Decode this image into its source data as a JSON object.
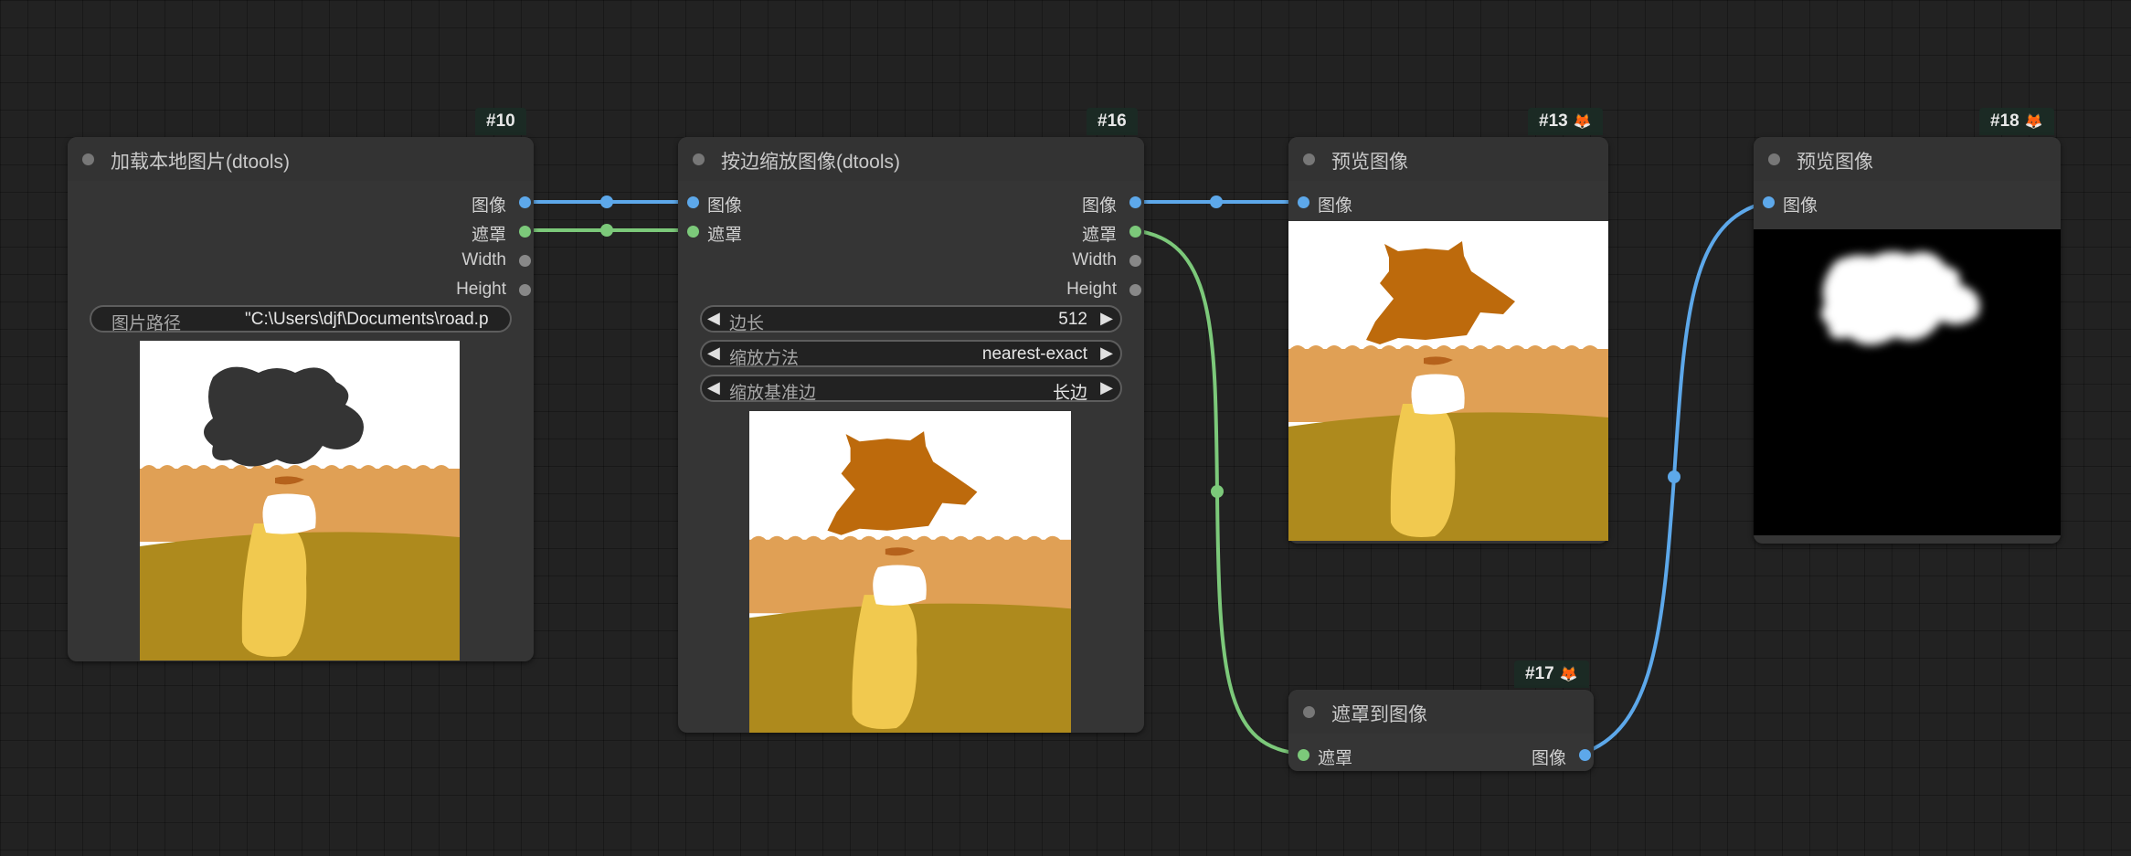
{
  "nodes": {
    "n10": {
      "id": "#10",
      "title": "加载本地图片(dtools)",
      "outputs": [
        "图像",
        "遮罩",
        "Width",
        "Height"
      ],
      "path_label": "图片路径",
      "path_value": "\"C:\\Users\\djf\\Documents\\road.p"
    },
    "n16": {
      "id": "#16",
      "title": "按边缩放图像(dtools)",
      "inputs": [
        "图像",
        "遮罩"
      ],
      "outputs": [
        "图像",
        "遮罩",
        "Width",
        "Height"
      ],
      "widgets": [
        {
          "label": "边长",
          "value": "512"
        },
        {
          "label": "缩放方法",
          "value": "nearest-exact"
        },
        {
          "label": "缩放基准边",
          "value": "长边"
        }
      ]
    },
    "n13": {
      "id": "#13",
      "title": "预览图像",
      "inputs": [
        "图像"
      ]
    },
    "n18": {
      "id": "#18",
      "title": "预览图像",
      "inputs": [
        "图像"
      ]
    },
    "n17": {
      "id": "#17",
      "title": "遮罩到图像",
      "inputs": [
        "遮罩"
      ],
      "outputs": [
        "图像"
      ]
    }
  },
  "colors": {
    "image_link": "#5da8ea",
    "mask_link": "#7cc97a",
    "canvas_bg": "#222222",
    "node_bg": "#353535"
  },
  "icons": {
    "fox_badge": "fox-icon",
    "widget_left": "triangle-left-icon",
    "widget_right": "triangle-right-icon"
  }
}
